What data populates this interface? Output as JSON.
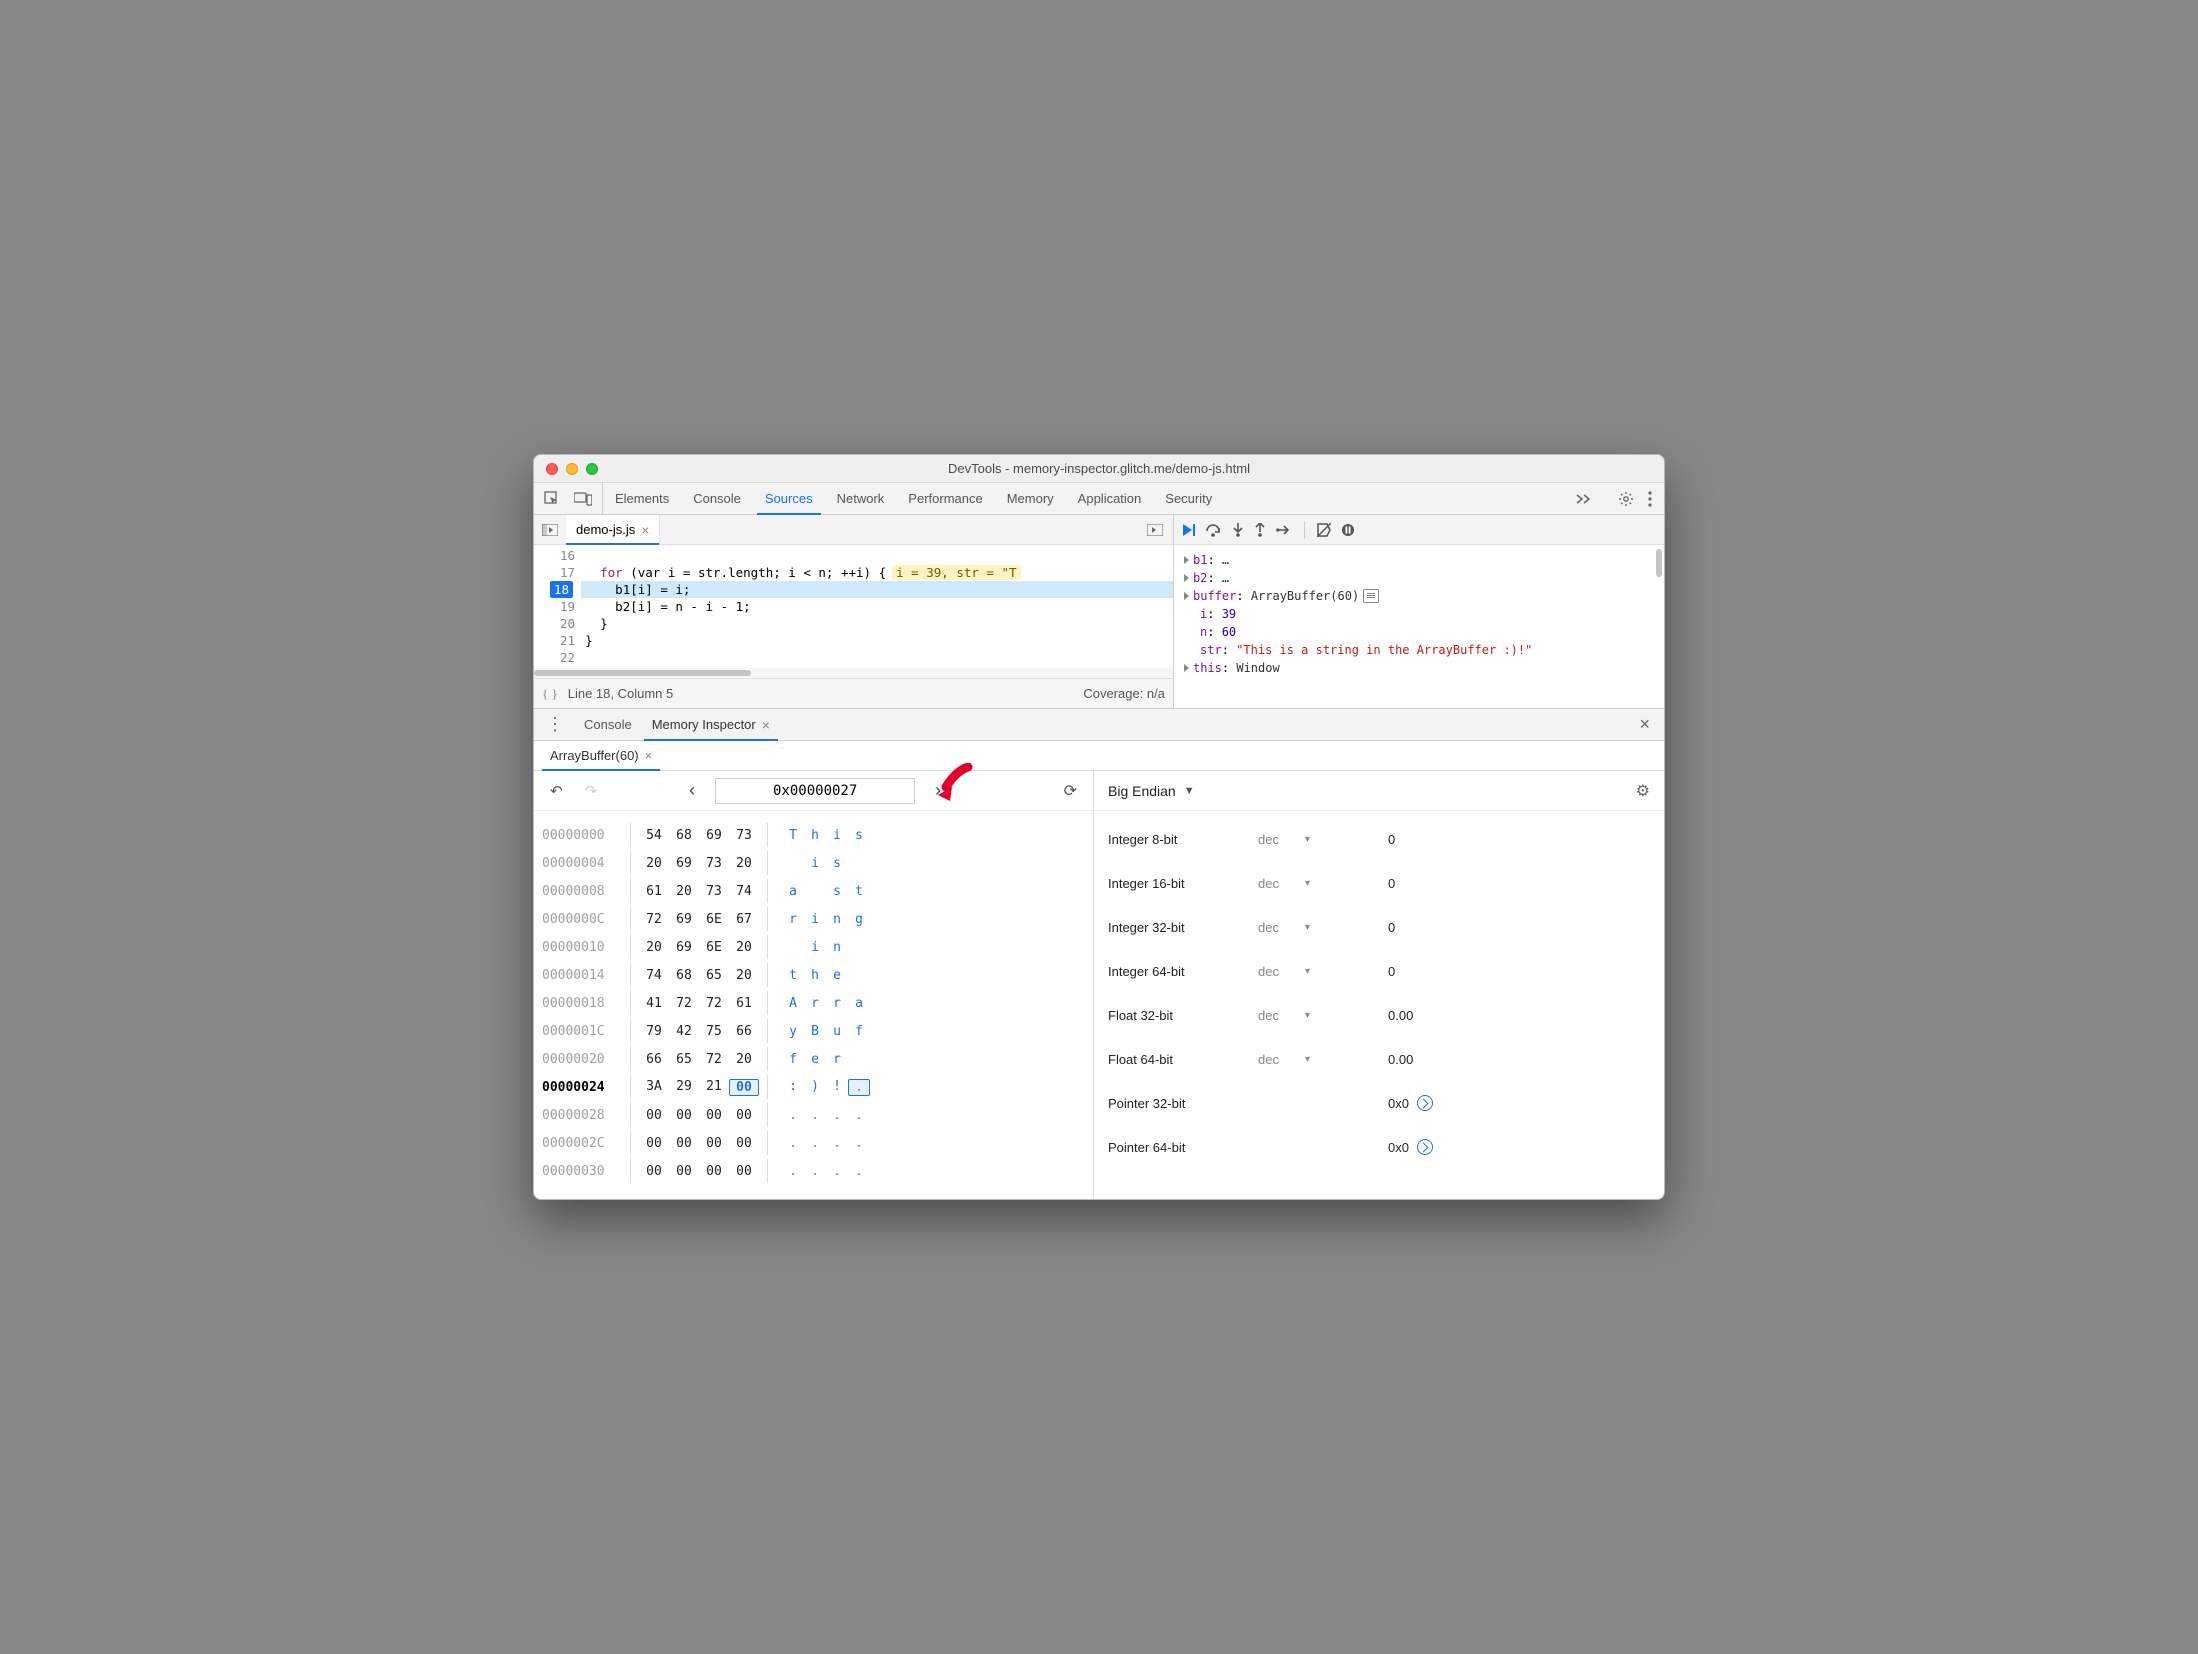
{
  "window": {
    "title": "DevTools - memory-inspector.glitch.me/demo-js.html"
  },
  "tabs": [
    "Elements",
    "Console",
    "Sources",
    "Network",
    "Performance",
    "Memory",
    "Application",
    "Security"
  ],
  "activeTab": "Sources",
  "sourceFile": {
    "name": "demo-js.js"
  },
  "code": {
    "gutterStart": 16,
    "activeLine": 18,
    "lines": {
      "l16": "",
      "l17_for": "for",
      "l17_rest": " (var i = str.length; i < n; ++i) {",
      "l17_inline": "i = 39, str = \"T",
      "l18": "    b1[i] = i;",
      "l19": "    b2[i] = n - i - 1;",
      "l20": "  }",
      "l21": "}",
      "l22": ""
    }
  },
  "status": {
    "pos": "Line 18, Column 5",
    "coverage": "Coverage: n/a"
  },
  "scope": {
    "b1": "…",
    "b2": "…",
    "bufferLabel": "buffer",
    "bufferVal": "ArrayBuffer(60)",
    "iLabel": "i",
    "iVal": "39",
    "nLabel": "n",
    "nVal": "60",
    "strLabel": "str",
    "strVal": "\"This is a string in the ArrayBuffer :)!\"",
    "thisLabel": "this",
    "thisVal": "Window"
  },
  "drawer": {
    "tabs": [
      "Console",
      "Memory Inspector"
    ],
    "active": "Memory Inspector"
  },
  "mi": {
    "tab": "ArrayBuffer(60)",
    "address": "0x00000027",
    "endianness": "Big Endian",
    "rows": [
      {
        "a": "00000000",
        "b": [
          "54",
          "68",
          "69",
          "73"
        ],
        "c": [
          "T",
          "h",
          "i",
          "s"
        ]
      },
      {
        "a": "00000004",
        "b": [
          "20",
          "69",
          "73",
          "20"
        ],
        "c": [
          " ",
          "i",
          "s",
          " "
        ]
      },
      {
        "a": "00000008",
        "b": [
          "61",
          "20",
          "73",
          "74"
        ],
        "c": [
          "a",
          " ",
          "s",
          "t"
        ]
      },
      {
        "a": "0000000C",
        "b": [
          "72",
          "69",
          "6E",
          "67"
        ],
        "c": [
          "r",
          "i",
          "n",
          "g"
        ]
      },
      {
        "a": "00000010",
        "b": [
          "20",
          "69",
          "6E",
          "20"
        ],
        "c": [
          " ",
          "i",
          "n",
          " "
        ]
      },
      {
        "a": "00000014",
        "b": [
          "74",
          "68",
          "65",
          "20"
        ],
        "c": [
          "t",
          "h",
          "e",
          " "
        ]
      },
      {
        "a": "00000018",
        "b": [
          "41",
          "72",
          "72",
          "61"
        ],
        "c": [
          "A",
          "r",
          "r",
          "a"
        ]
      },
      {
        "a": "0000001C",
        "b": [
          "79",
          "42",
          "75",
          "66"
        ],
        "c": [
          "y",
          "B",
          "u",
          "f"
        ]
      },
      {
        "a": "00000020",
        "b": [
          "66",
          "65",
          "72",
          "20"
        ],
        "c": [
          "f",
          "e",
          "r",
          " "
        ]
      },
      {
        "a": "00000024",
        "b": [
          "3A",
          "29",
          "21",
          "00"
        ],
        "c": [
          ":",
          ")",
          "!",
          "."
        ],
        "selByte": 3,
        "bold": true
      },
      {
        "a": "00000028",
        "b": [
          "00",
          "00",
          "00",
          "00"
        ],
        "c": [
          ".",
          ".",
          ".",
          "."
        ]
      },
      {
        "a": "0000002C",
        "b": [
          "00",
          "00",
          "00",
          "00"
        ],
        "c": [
          ".",
          ".",
          ".",
          "."
        ]
      },
      {
        "a": "00000030",
        "b": [
          "00",
          "00",
          "00",
          "00"
        ],
        "c": [
          ".",
          ".",
          ".",
          "."
        ]
      }
    ],
    "values": [
      {
        "label": "Integer 8-bit",
        "enc": "dec",
        "val": "0"
      },
      {
        "label": "Integer 16-bit",
        "enc": "dec",
        "val": "0"
      },
      {
        "label": "Integer 32-bit",
        "enc": "dec",
        "val": "0"
      },
      {
        "label": "Integer 64-bit",
        "enc": "dec",
        "val": "0"
      },
      {
        "label": "Float 32-bit",
        "enc": "dec",
        "val": "0.00"
      },
      {
        "label": "Float 64-bit",
        "enc": "dec",
        "val": "0.00"
      },
      {
        "label": "Pointer 32-bit",
        "enc": "",
        "val": "0x0",
        "link": true
      },
      {
        "label": "Pointer 64-bit",
        "enc": "",
        "val": "0x0",
        "link": true
      }
    ]
  }
}
